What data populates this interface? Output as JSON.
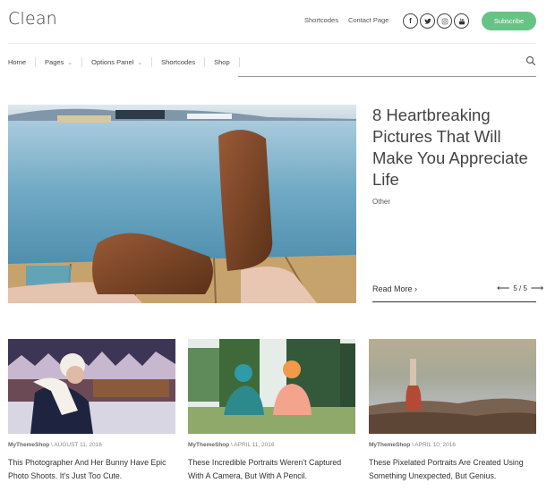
{
  "site": {
    "logo": "Clean"
  },
  "header": {
    "top_links": [
      "Shortcodes",
      "Contact Page"
    ],
    "socials": [
      {
        "icon": "facebook-icon",
        "glyph": "f"
      },
      {
        "icon": "twitter-icon",
        "glyph": "t"
      },
      {
        "icon": "instagram-icon",
        "glyph": "◎"
      },
      {
        "icon": "youtube-icon",
        "glyph": "▣"
      }
    ],
    "subscribe_label": "Subscribe",
    "subscribe_color": "#67c285"
  },
  "nav": {
    "items": [
      {
        "label": "Home",
        "dropdown": false
      },
      {
        "label": "Pages",
        "dropdown": true
      },
      {
        "label": "Options Panel",
        "dropdown": true
      },
      {
        "label": "Shortcodes",
        "dropdown": false
      },
      {
        "label": "Shop",
        "dropdown": false
      }
    ],
    "search_placeholder": ""
  },
  "hero": {
    "title": "8 Heartbreaking Pictures That Will Make You Appreciate Life",
    "category": "Other",
    "read_more": "Read More ›",
    "pager": {
      "current": "5",
      "total": "5",
      "text": "5 / 5",
      "prev": "⟵",
      "next": "⟶"
    }
  },
  "cards": [
    {
      "author": "MyThemeShop",
      "date": "AUGUST 11, 2016",
      "title": "This Photographer And Her Bunny Have Epic Photo Shoots. It's Just Too Cute."
    },
    {
      "author": "MyThemeShop",
      "date": "APRIL 11, 2016",
      "title": "These Incredible Portraits Weren't Captured With A Camera, But With A Pencil."
    },
    {
      "author": "MyThemeShop",
      "date": "APRIL 10, 2016",
      "title": "These Pixelated Portraits Are Created Using Something Unexpected, But Genius."
    }
  ]
}
